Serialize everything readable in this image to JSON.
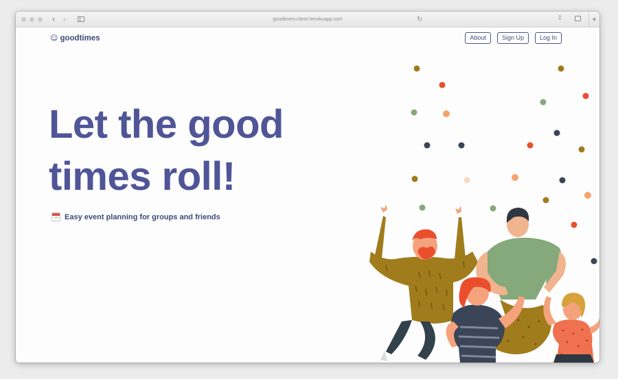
{
  "browser": {
    "url": "goodtimes-client.herokuapp.com",
    "back_icon": "‹",
    "forward_icon": "›",
    "reload_icon": "↻",
    "share_icon": "⇪",
    "new_tab_icon": "+"
  },
  "header": {
    "logo_icon": "☺",
    "logo_text": "goodtimes",
    "nav": [
      "About",
      "Sign Up",
      "Log In"
    ]
  },
  "hero": {
    "title_line1": "Let the good",
    "title_line2": "times roll!",
    "subtitle": "Easy event planning for groups and friends"
  },
  "colors": {
    "brand": "#4f5597",
    "confetti_orange": "#e94e2d",
    "confetti_mustard": "#a07c1d",
    "confetti_green": "#85a97a",
    "confetti_navy": "#3b4558",
    "confetti_peach": "#f3a56d"
  }
}
